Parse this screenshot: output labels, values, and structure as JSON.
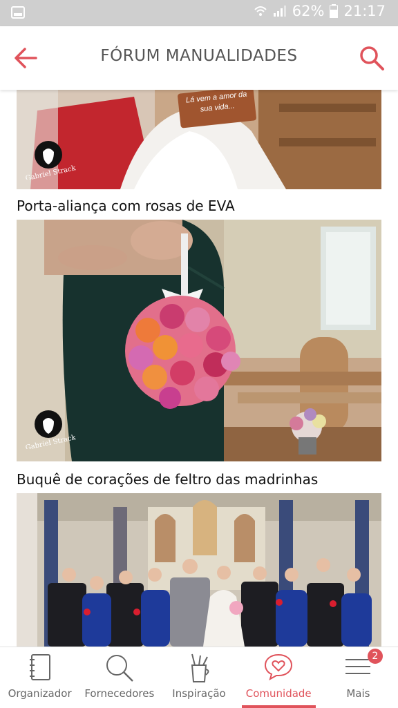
{
  "status_bar": {
    "battery": "62%",
    "time": "21:17"
  },
  "header": {
    "title": "FÓRUM MANUALIDADES",
    "accent": "#e0535b"
  },
  "posts": [
    {
      "caption": "",
      "watermark": "Gabriel Strack"
    },
    {
      "caption": "Porta-aliança com rosas de EVA",
      "watermark": "Gabriel Strack"
    },
    {
      "caption": "Buquê de corações de feltro das madrinhas"
    }
  ],
  "sign_text": "Lá vem a amor da sua vida...",
  "bottom_nav": {
    "items": [
      {
        "label": "Organizador",
        "icon": "notebook-icon"
      },
      {
        "label": "Fornecedores",
        "icon": "search-icon"
      },
      {
        "label": "Inspiração",
        "icon": "pencil-cup-icon"
      },
      {
        "label": "Comunidade",
        "icon": "heart-chat-icon",
        "active": true
      },
      {
        "label": "Mais",
        "icon": "menu-icon",
        "badge": "2"
      }
    ]
  }
}
